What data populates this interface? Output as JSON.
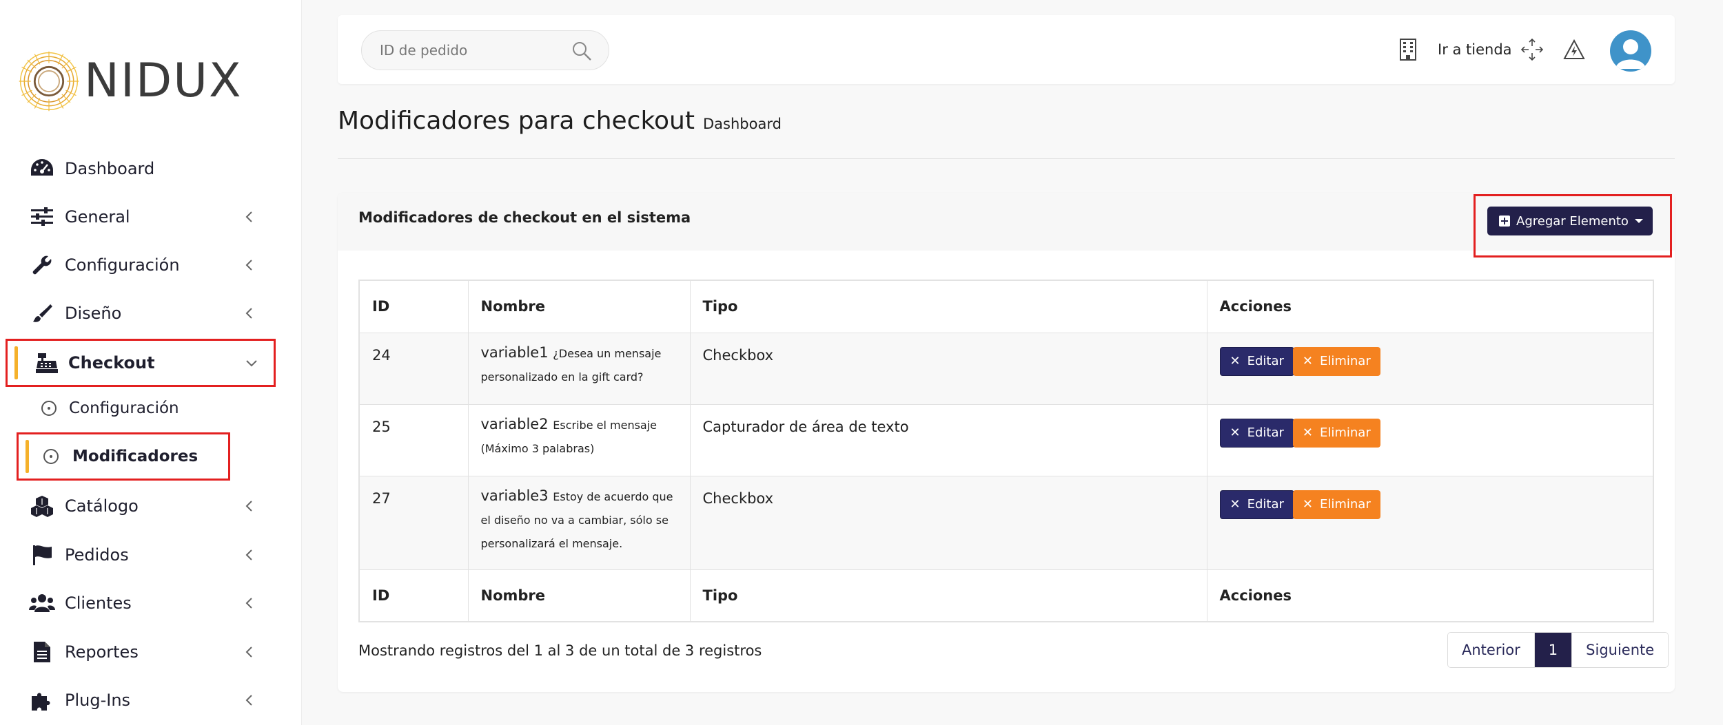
{
  "brand": {
    "logo_text": "NIDUX"
  },
  "sidebar": {
    "items": [
      {
        "label": "Dashboard",
        "icon": "dashboard-gauge-icon",
        "has_chevron": false
      },
      {
        "label": "General",
        "icon": "sliders-icon",
        "has_chevron": true
      },
      {
        "label": "Configuración",
        "icon": "wrench-icon",
        "has_chevron": true
      },
      {
        "label": "Diseño",
        "icon": "paintbrush-icon",
        "has_chevron": true
      },
      {
        "label": "Checkout",
        "icon": "cash-register-icon",
        "has_chevron": true,
        "expanded": true
      },
      {
        "label": "Catálogo",
        "icon": "cubes-icon",
        "has_chevron": true
      },
      {
        "label": "Pedidos",
        "icon": "flag-icon",
        "has_chevron": true
      },
      {
        "label": "Clientes",
        "icon": "users-icon",
        "has_chevron": true
      },
      {
        "label": "Reportes",
        "icon": "file-icon",
        "has_chevron": true
      },
      {
        "label": "Plug-Ins",
        "icon": "puzzle-icon",
        "has_chevron": true
      }
    ],
    "checkout_sub": [
      {
        "label": "Configuración"
      },
      {
        "label": "Modificadores",
        "active": true
      }
    ]
  },
  "topbar": {
    "search_placeholder": "ID de pedido",
    "store_link": "Ir a tienda"
  },
  "page": {
    "title": "Modificadores para checkout",
    "breadcrumb": "Dashboard"
  },
  "card": {
    "title": "Modificadores de checkout en el sistema",
    "add_button": "Agregar Elemento"
  },
  "table": {
    "columns": [
      "ID",
      "Nombre",
      "Tipo",
      "Acciones"
    ],
    "rows": [
      {
        "id": "24",
        "name": "variable1",
        "desc": "¿Desea un mensaje personalizado en la gift card?",
        "type": "Checkbox"
      },
      {
        "id": "25",
        "name": "variable2",
        "desc": "Escribe el mensaje (Máximo 3 palabras)",
        "type": "Capturador de área de texto"
      },
      {
        "id": "27",
        "name": "variable3",
        "desc": "Estoy de acuerdo que el diseño no va a cambiar, sólo se personalizará el mensaje.",
        "type": "Checkbox"
      }
    ],
    "edit_label": "Editar",
    "delete_label": "Eliminar"
  },
  "footer": {
    "info": "Mostrando registros del 1 al 3 de un total de 3 registros",
    "prev": "Anterior",
    "page": "1",
    "next": "Siguiente"
  },
  "colors": {
    "primary_dark": "#23204a",
    "edit_button": "#2a2a6a",
    "delete_button": "#f58220",
    "highlight_border": "#e32020",
    "active_bar": "#f5b12a",
    "avatar": "#3f93c9"
  }
}
